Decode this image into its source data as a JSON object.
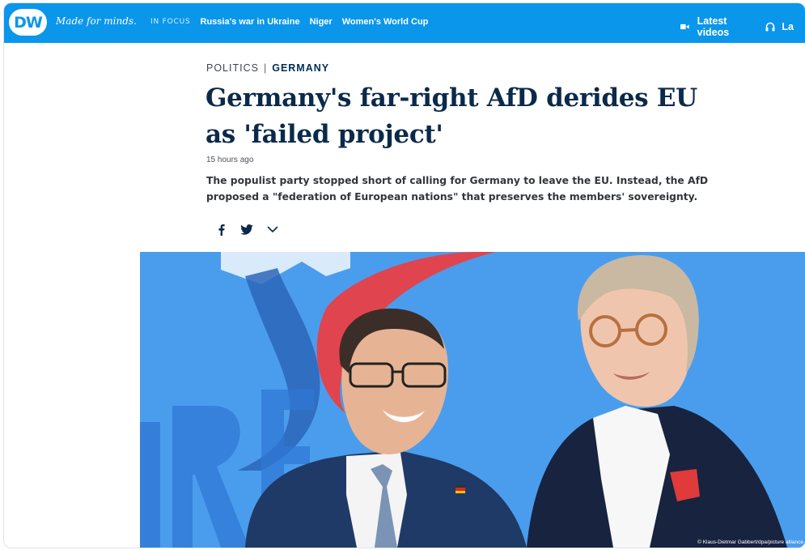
{
  "brand": {
    "logo_text": "DW",
    "tagline": "Made for minds."
  },
  "nav": {
    "focus_label": "IN FOCUS",
    "links": [
      "Russia's war in Ukraine",
      "Niger",
      "Women's World Cup"
    ],
    "latest_videos": "Latest videos",
    "truncated_item": "La"
  },
  "article": {
    "category": "POLITICS",
    "separator": "|",
    "subcategory": "GERMANY",
    "headline": "Germany's far-right AfD derides EU as 'failed project'",
    "time": "15 hours ago",
    "teaser": "The populist party stopped short of calling for Germany to leave the EU. Instead, the AfD proposed a \"federation of European nations\" that preserves the members' sovereignty."
  },
  "share": {
    "icons": [
      "facebook-icon",
      "twitter-icon",
      "chevron-down-icon"
    ]
  },
  "image": {
    "credit": "© Klaus-Dietmar Gabbert/dpa/picture alliance"
  },
  "colors": {
    "topbar": "#0a96ea",
    "headline": "#0b2a4a",
    "hero_background": "#3f95e6",
    "afd_red": "#e0444e"
  }
}
